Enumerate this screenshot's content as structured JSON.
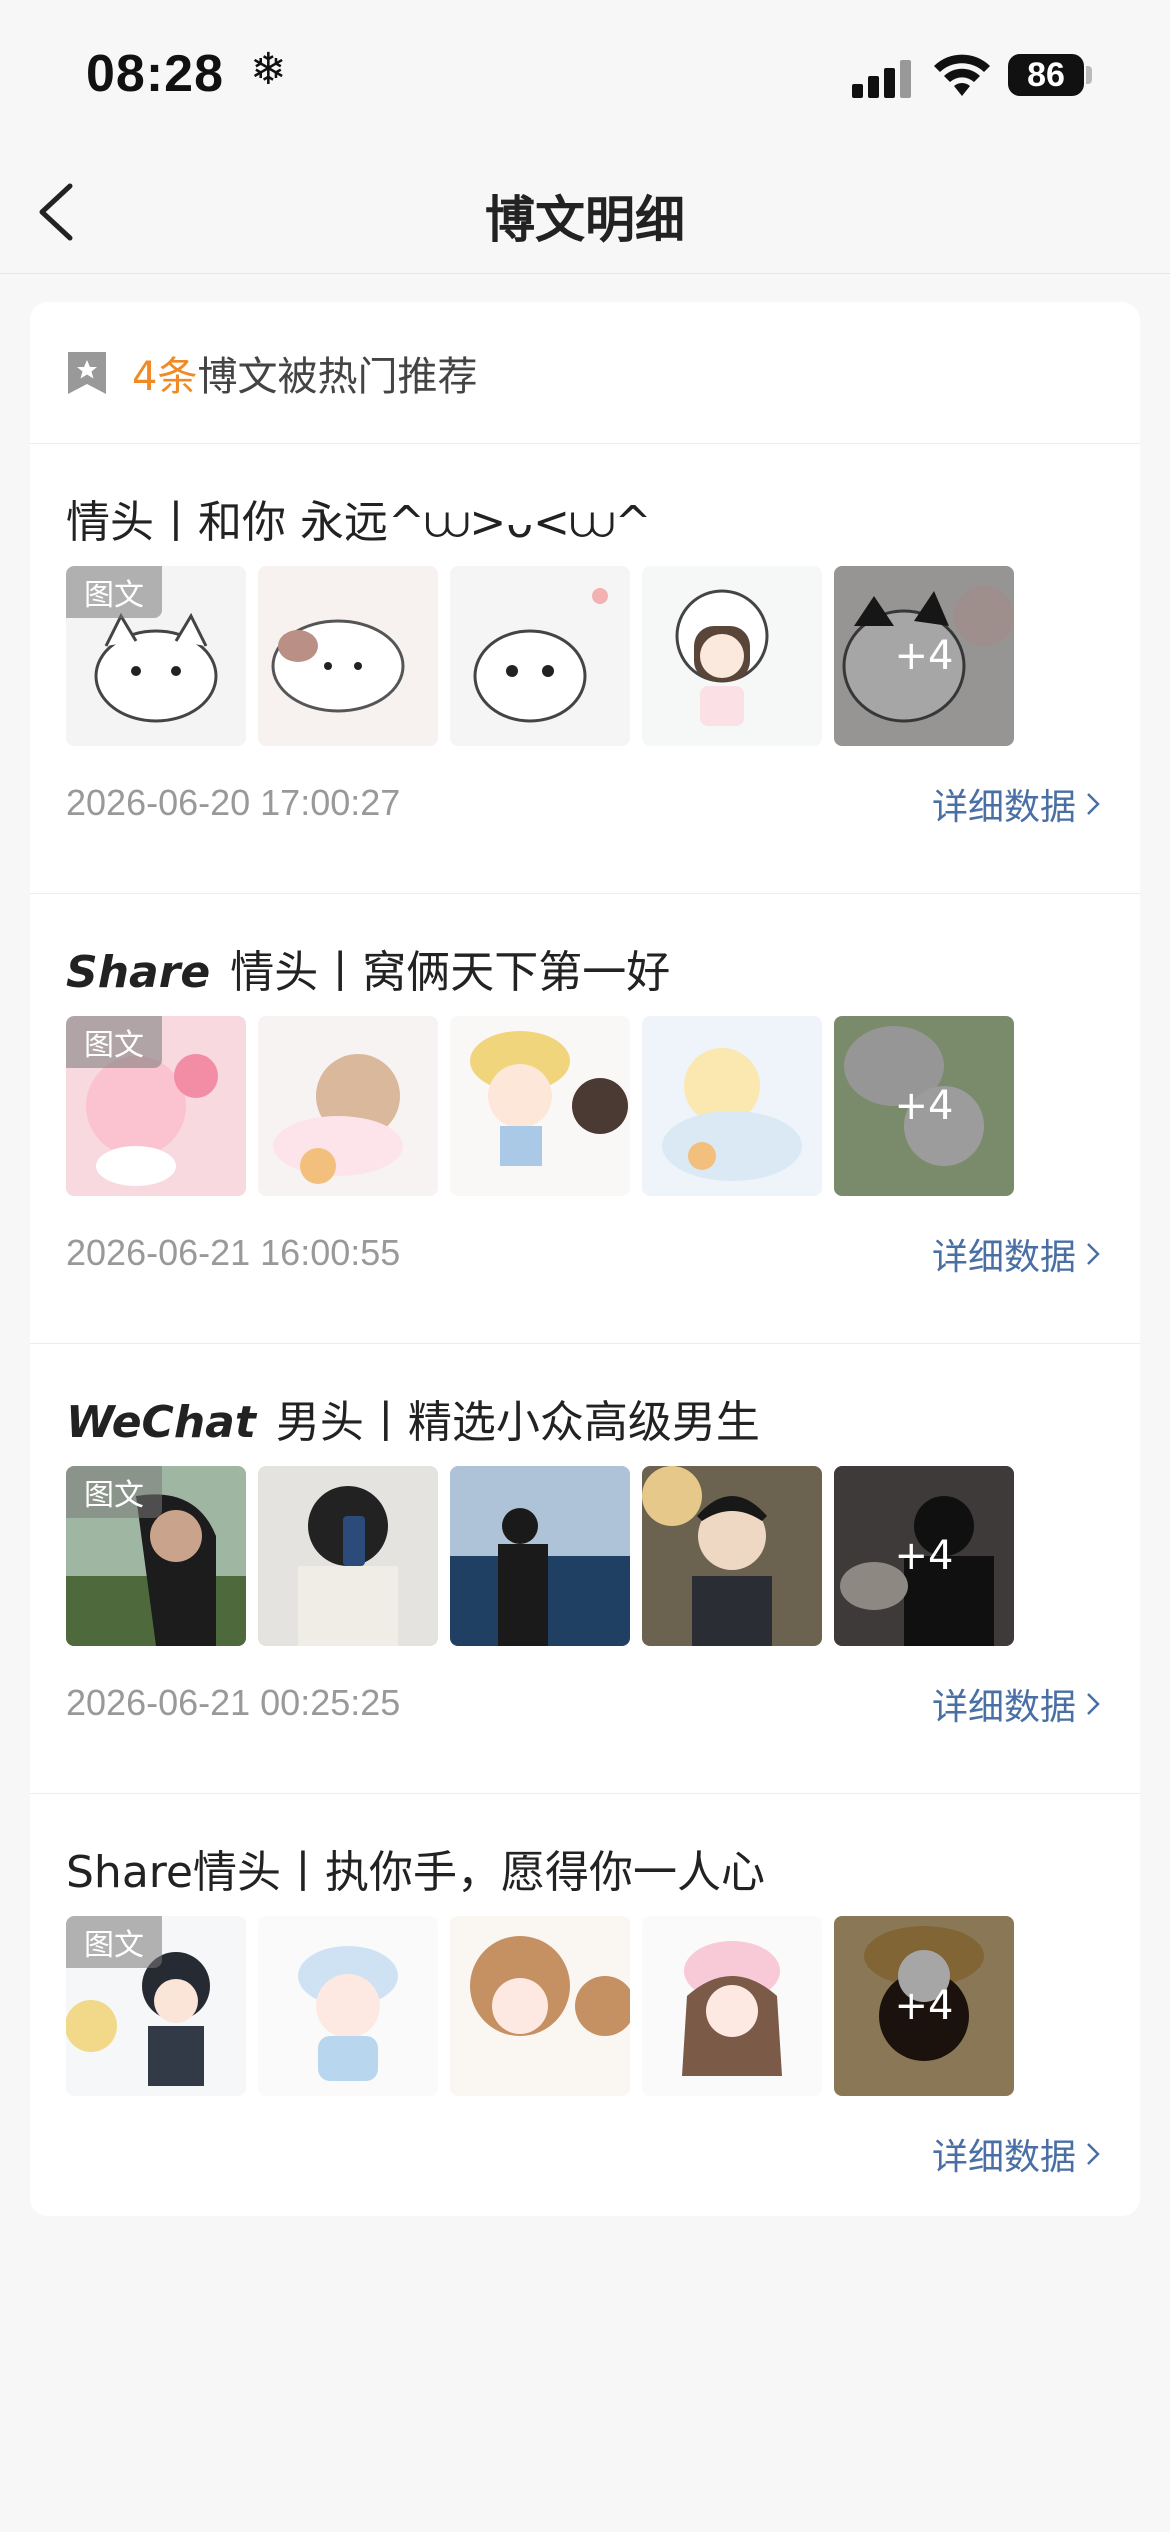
{
  "status": {
    "time": "08:28",
    "battery": "86"
  },
  "nav": {
    "title": "博文明细"
  },
  "summary": {
    "count": "4条",
    "text": "博文被热门推荐"
  },
  "badge_label": "图文",
  "detail_label": "详细数据",
  "more_label": "+4",
  "posts": [
    {
      "brand": "",
      "title": "情头丨和你 永远^⩊>ᴗ<⩊^",
      "date": "2026-06-20 17:00:27"
    },
    {
      "brand": "Share",
      "title": "情头丨窝俩天下第一好",
      "date": "2026-06-21 16:00:55"
    },
    {
      "brand": "WeChat",
      "title": "男头丨精选小众高级男生",
      "date": "2026-06-21 00:25:25"
    },
    {
      "brand": "",
      "title": "Share情头丨执你手，愿得你一人心",
      "date": ""
    }
  ]
}
